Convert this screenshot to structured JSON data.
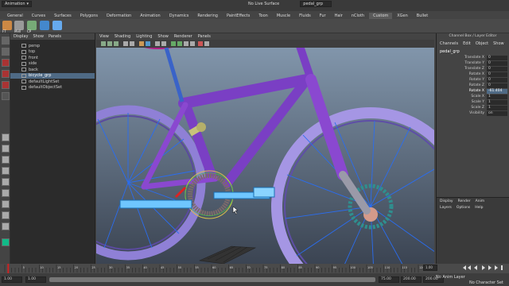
{
  "title_bar": {
    "mode": "Animation",
    "snap_item": "No Live Surface",
    "object_field": "pedal_grp"
  },
  "shelf_tabs": [
    "General",
    "Curves",
    "Surfaces",
    "Polygons",
    "Deformation",
    "Animation",
    "Dynamics",
    "Rendering",
    "PaintEffects",
    "Toon",
    "Muscle",
    "Fluids",
    "Fur",
    "Hair",
    "nCloth",
    "Custom",
    "XGen",
    "Bullet"
  ],
  "shelf_active": "Custom",
  "shelf_labels": [
    "FT",
    "Mell",
    "CP"
  ],
  "outliner": {
    "menu": [
      "Display",
      "Show",
      "Panels"
    ],
    "items": [
      "persp",
      "top",
      "front",
      "side",
      "back",
      "bicycle_grp",
      "defaultLightSet",
      "defaultObjectSet"
    ],
    "selected_index": 5
  },
  "viewport": {
    "menu": [
      "View",
      "Shading",
      "Lighting",
      "Show",
      "Renderer",
      "Panels"
    ]
  },
  "channel_box": {
    "title": "Channel Box / Layer Editor",
    "menu": [
      "Channels",
      "Edit",
      "Object",
      "Show"
    ],
    "object": "pedal_grp",
    "attributes": [
      {
        "name": "Translate X",
        "value": "0"
      },
      {
        "name": "Translate Y",
        "value": "0"
      },
      {
        "name": "Translate Z",
        "value": "0"
      },
      {
        "name": "Rotate X",
        "value": "0"
      },
      {
        "name": "Rotate Y",
        "value": "0"
      },
      {
        "name": "Rotate Z",
        "value": "0"
      },
      {
        "name": "Rotate X",
        "value": "-61.404"
      },
      {
        "name": "Scale X",
        "value": "1"
      },
      {
        "name": "Scale Y",
        "value": "1"
      },
      {
        "name": "Scale Z",
        "value": "1"
      },
      {
        "name": "Visibility",
        "value": "on"
      }
    ],
    "selected_attr_index": 6,
    "layer_tabs": [
      "Display",
      "Render",
      "Anim"
    ],
    "layer_menu": [
      "Layers",
      "Options",
      "Help"
    ]
  },
  "timeline": {
    "ticks": [
      "5",
      "10",
      "15",
      "20",
      "25",
      "30",
      "35",
      "40",
      "45",
      "50",
      "55",
      "60",
      "65",
      "70",
      "75",
      "80",
      "85",
      "90",
      "95",
      "100",
      "105",
      "110",
      "115",
      "120"
    ],
    "current_frame": "1.00",
    "start": "1.00",
    "range_start": "1.00",
    "range_end": "75.00",
    "end_a": "200.00",
    "end_b": "200.00",
    "anim_layer": "No Anim Layer",
    "char_set": "No Character Set"
  },
  "colors": {
    "bike_purple": "#7a3fc4",
    "wheel_lavender": "#9e8ee0",
    "spoke_blue": "#2a6df0",
    "selection_blue": "#4f6a85"
  }
}
